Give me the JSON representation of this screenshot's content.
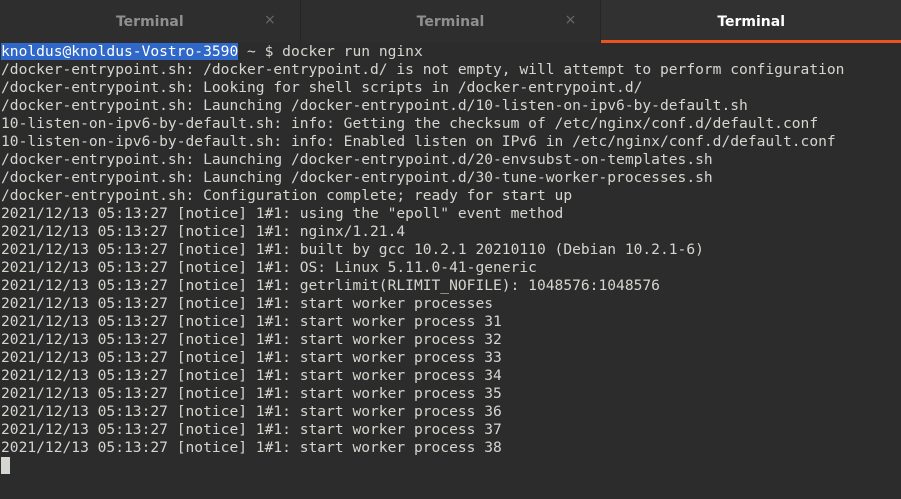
{
  "tabs": [
    {
      "label": "Terminal",
      "close": "×",
      "active": false
    },
    {
      "label": "Terminal",
      "close": "×",
      "active": false
    },
    {
      "label": "Terminal",
      "active": true
    }
  ],
  "prompt": {
    "user_host": "knoldus@knoldus-Vostro-3590",
    "path_symbol": " ~ $ ",
    "command": "docker run nginx"
  },
  "output_lines": [
    "/docker-entrypoint.sh: /docker-entrypoint.d/ is not empty, will attempt to perform configuration",
    "/docker-entrypoint.sh: Looking for shell scripts in /docker-entrypoint.d/",
    "/docker-entrypoint.sh: Launching /docker-entrypoint.d/10-listen-on-ipv6-by-default.sh",
    "10-listen-on-ipv6-by-default.sh: info: Getting the checksum of /etc/nginx/conf.d/default.conf",
    "10-listen-on-ipv6-by-default.sh: info: Enabled listen on IPv6 in /etc/nginx/conf.d/default.conf",
    "/docker-entrypoint.sh: Launching /docker-entrypoint.d/20-envsubst-on-templates.sh",
    "/docker-entrypoint.sh: Launching /docker-entrypoint.d/30-tune-worker-processes.sh",
    "/docker-entrypoint.sh: Configuration complete; ready for start up",
    "2021/12/13 05:13:27 [notice] 1#1: using the \"epoll\" event method",
    "2021/12/13 05:13:27 [notice] 1#1: nginx/1.21.4",
    "2021/12/13 05:13:27 [notice] 1#1: built by gcc 10.2.1 20210110 (Debian 10.2.1-6)",
    "2021/12/13 05:13:27 [notice] 1#1: OS: Linux 5.11.0-41-generic",
    "2021/12/13 05:13:27 [notice] 1#1: getrlimit(RLIMIT_NOFILE): 1048576:1048576",
    "2021/12/13 05:13:27 [notice] 1#1: start worker processes",
    "2021/12/13 05:13:27 [notice] 1#1: start worker process 31",
    "2021/12/13 05:13:27 [notice] 1#1: start worker process 32",
    "2021/12/13 05:13:27 [notice] 1#1: start worker process 33",
    "2021/12/13 05:13:27 [notice] 1#1: start worker process 34",
    "2021/12/13 05:13:27 [notice] 1#1: start worker process 35",
    "2021/12/13 05:13:27 [notice] 1#1: start worker process 36",
    "2021/12/13 05:13:27 [notice] 1#1: start worker process 37",
    "2021/12/13 05:13:27 [notice] 1#1: start worker process 38"
  ],
  "colors": {
    "background": "#2c2c2c",
    "text": "#d3d7cf",
    "prompt_highlight": "#2f68c8",
    "active_tab_accent": "#e95420"
  }
}
